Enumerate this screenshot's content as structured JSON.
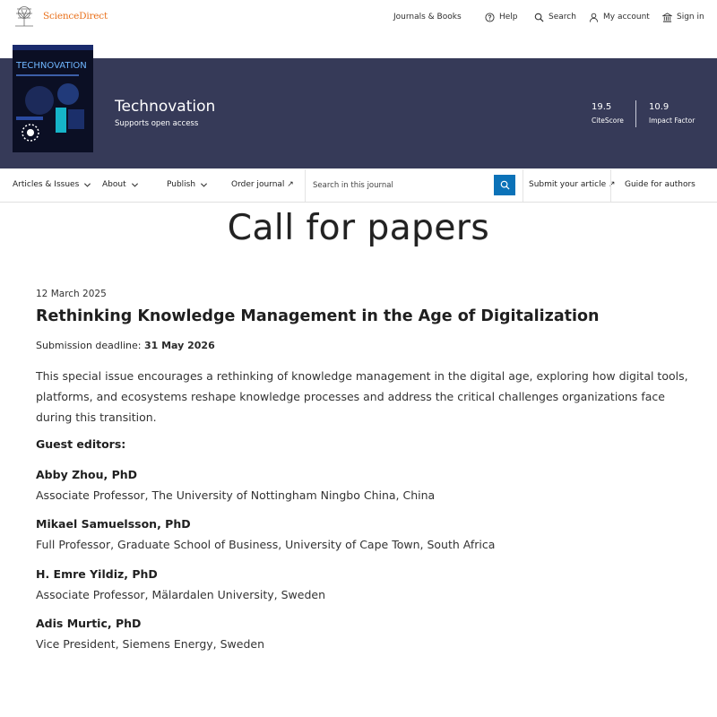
{
  "header": {
    "brand": "ScienceDirect",
    "nav": [
      {
        "label": "Journals & Books",
        "icon": ""
      },
      {
        "label": "Help",
        "icon": "help-icon"
      },
      {
        "label": "Search",
        "icon": "search-icon"
      },
      {
        "label": "My account",
        "icon": "user-icon"
      },
      {
        "label": "Sign in",
        "icon": "institution-icon"
      }
    ]
  },
  "journal": {
    "title": "Technovation",
    "subtitle": "Supports open access",
    "cover_title": "TECHNOVATION",
    "metrics": [
      {
        "value": "19.5",
        "label": "CiteScore"
      },
      {
        "value": "10.9",
        "label": "Impact Factor"
      }
    ]
  },
  "journal_nav": {
    "articles": "Articles & Issues",
    "about": "About",
    "publish": "Publish",
    "order": "Order journal ↗",
    "search_placeholder": "Search in this journal",
    "submit": "Submit your article ↗",
    "guide": "Guide for authors"
  },
  "hero": {
    "title": "Call for papers"
  },
  "article": {
    "date": "12 March 2025",
    "title": "Rethinking Knowledge Management in the Age of Digitalization",
    "deadline_label": "Submission deadline: ",
    "deadline_value": "31 May 2026",
    "description": "This special issue encourages a rethinking of knowledge management in the digital age, exploring how digital tools, platforms, and ecosystems reshape knowledge processes and address the critical challenges organizations face during this transition.",
    "editors_label": "Guest editors:",
    "editors": [
      {
        "name": "Abby Zhou, PhD",
        "affiliation": "Associate Professor, The University of Nottingham Ningbo China, China"
      },
      {
        "name": "Mikael Samuelsson, PhD",
        "affiliation": "Full Professor, Graduate School of Business, University of Cape Town, South Africa"
      },
      {
        "name": "H. Emre Yildiz, PhD",
        "affiliation": "Associate Professor, Mälardalen University, Sweden"
      },
      {
        "name": "Adis Murtic, PhD",
        "affiliation": "Vice President, Siemens Energy, Sweden"
      }
    ]
  },
  "colors": {
    "banner": "#363a58",
    "brand_orange": "#e9711c",
    "search_button": "#0b72b8"
  }
}
